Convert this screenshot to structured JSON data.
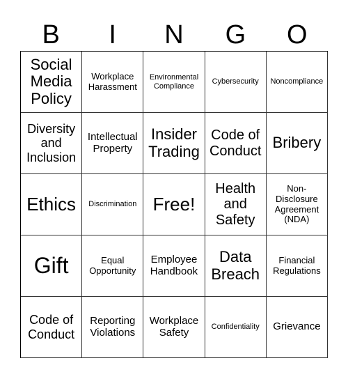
{
  "header": [
    "B",
    "I",
    "N",
    "G",
    "O"
  ],
  "cells": [
    {
      "text": "Social Media Policy",
      "size": "xxl"
    },
    {
      "text": "Workplace Harassment",
      "size": "sm"
    },
    {
      "text": "Environmental Compliance",
      "size": "xs"
    },
    {
      "text": "Cybersecurity",
      "size": "xs"
    },
    {
      "text": "Noncompliance",
      "size": "xs"
    },
    {
      "text": "Diversity and Inclusion",
      "size": "lg"
    },
    {
      "text": "Intellectual Property",
      "size": "md"
    },
    {
      "text": "Insider Trading",
      "size": "xxl"
    },
    {
      "text": "Code of Conduct",
      "size": "xl"
    },
    {
      "text": "Bribery",
      "size": "xxl"
    },
    {
      "text": "Ethics",
      "size": "huge"
    },
    {
      "text": "Discrimination",
      "size": "xs"
    },
    {
      "text": "Free!",
      "size": "huge"
    },
    {
      "text": "Health and Safety",
      "size": "xl"
    },
    {
      "text": "Non-Disclosure Agreement (NDA)",
      "size": "sm"
    },
    {
      "text": "Gift",
      "size": "giant"
    },
    {
      "text": "Equal Opportunity",
      "size": "sm"
    },
    {
      "text": "Employee Handbook",
      "size": "md"
    },
    {
      "text": "Data Breach",
      "size": "xxl"
    },
    {
      "text": "Financial Regulations",
      "size": "sm"
    },
    {
      "text": "Code of Conduct",
      "size": "lg"
    },
    {
      "text": "Reporting Violations",
      "size": "md"
    },
    {
      "text": "Workplace Safety",
      "size": "md"
    },
    {
      "text": "Confidentiality",
      "size": "xs"
    },
    {
      "text": "Grievance",
      "size": "md"
    }
  ]
}
